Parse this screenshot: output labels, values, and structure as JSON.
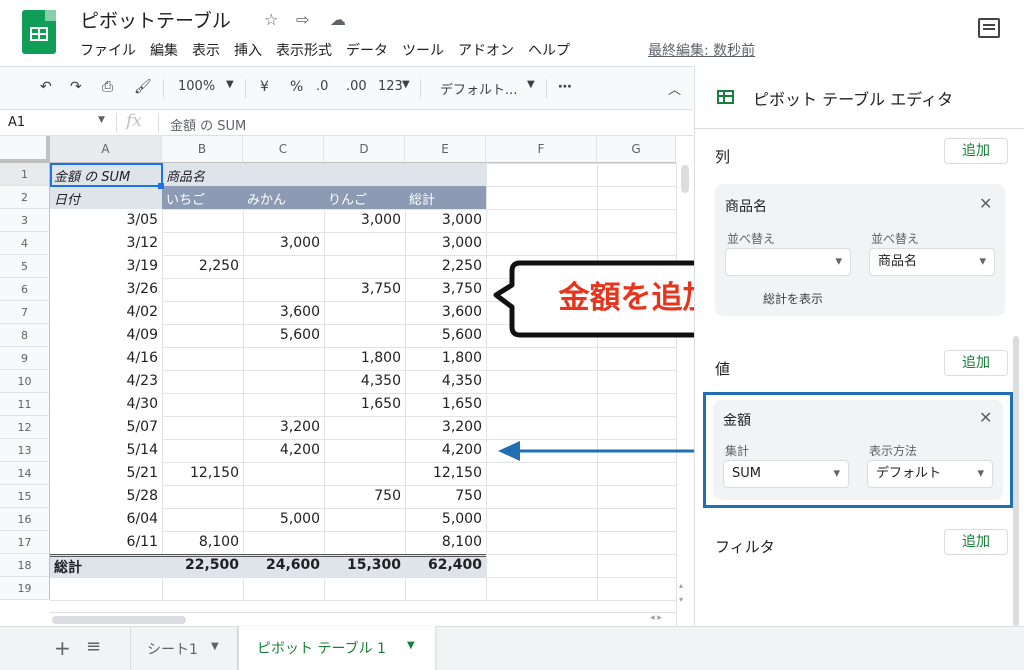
{
  "doc": {
    "title": "ピボットテーブル",
    "last_edit": "最終編集: 数秒前"
  },
  "menu": [
    "ファイル",
    "編集",
    "表示",
    "挿入",
    "表示形式",
    "データ",
    "ツール",
    "アドオン",
    "ヘルプ"
  ],
  "toolbar": {
    "zoom": "100%",
    "currency": "¥",
    "percent": "%",
    "dec_dec": ".0",
    "inc_dec": ".00",
    "format": "123",
    "font": "デフォルト..."
  },
  "formula": {
    "cell_ref": "A1",
    "fx": "fx",
    "content": "金額 の SUM"
  },
  "columns": [
    "A",
    "B",
    "C",
    "D",
    "E",
    "F",
    "G"
  ],
  "rows": [
    "1",
    "2",
    "3",
    "4",
    "5",
    "6",
    "7",
    "8",
    "9",
    "10",
    "11",
    "12",
    "13",
    "14",
    "15",
    "16",
    "17",
    "18",
    "19"
  ],
  "pivot": {
    "a1": "金額 の SUM",
    "b1": "商品名",
    "a2": "日付",
    "heads": [
      "いちご",
      "みかん",
      "りんご",
      "総計"
    ],
    "data": [
      [
        "3/05",
        "",
        "",
        "3,000",
        "3,000"
      ],
      [
        "3/12",
        "",
        "3,000",
        "",
        "3,000"
      ],
      [
        "3/19",
        "2,250",
        "",
        "",
        "2,250"
      ],
      [
        "3/26",
        "",
        "",
        "3,750",
        "3,750"
      ],
      [
        "4/02",
        "",
        "3,600",
        "",
        "3,600"
      ],
      [
        "4/09",
        "",
        "5,600",
        "",
        "5,600"
      ],
      [
        "4/16",
        "",
        "",
        "1,800",
        "1,800"
      ],
      [
        "4/23",
        "",
        "",
        "4,350",
        "4,350"
      ],
      [
        "4/30",
        "",
        "",
        "1,650",
        "1,650"
      ],
      [
        "5/07",
        "",
        "3,200",
        "",
        "3,200"
      ],
      [
        "5/14",
        "",
        "4,200",
        "",
        "4,200"
      ],
      [
        "5/21",
        "12,150",
        "",
        "",
        "12,150"
      ],
      [
        "5/28",
        "",
        "",
        "750",
        "750"
      ],
      [
        "6/04",
        "",
        "5,000",
        "",
        "5,000"
      ],
      [
        "6/11",
        "8,100",
        "",
        "",
        "8,100"
      ]
    ],
    "total": [
      "総計",
      "22,500",
      "24,600",
      "15,300",
      "62,400"
    ]
  },
  "callout": "金額を追加",
  "panel": {
    "title": "ピボット テーブル エディタ",
    "col_section": "列",
    "add": "追加",
    "col_card": {
      "name": "商品名",
      "sort_label": "並べ替え",
      "sort2_label": "並べ替え",
      "sort2_val": "商品名",
      "show_totals": "総計を表示"
    },
    "val_section": "値",
    "val_card": {
      "name": "金額",
      "agg_label": "集計",
      "agg_val": "SUM",
      "show_label": "表示方法",
      "show_val": "デフォルト"
    },
    "filter_section": "フィルタ"
  },
  "sheets": {
    "s1": "シート1",
    "s2": "ピボット テーブル 1"
  },
  "colors": {
    "green": "#188038",
    "header_blue": "#8c9ab3",
    "highlight": "#dfe3ea",
    "callout_red": "#e8341c",
    "arrow_blue": "#1f6fb2"
  }
}
